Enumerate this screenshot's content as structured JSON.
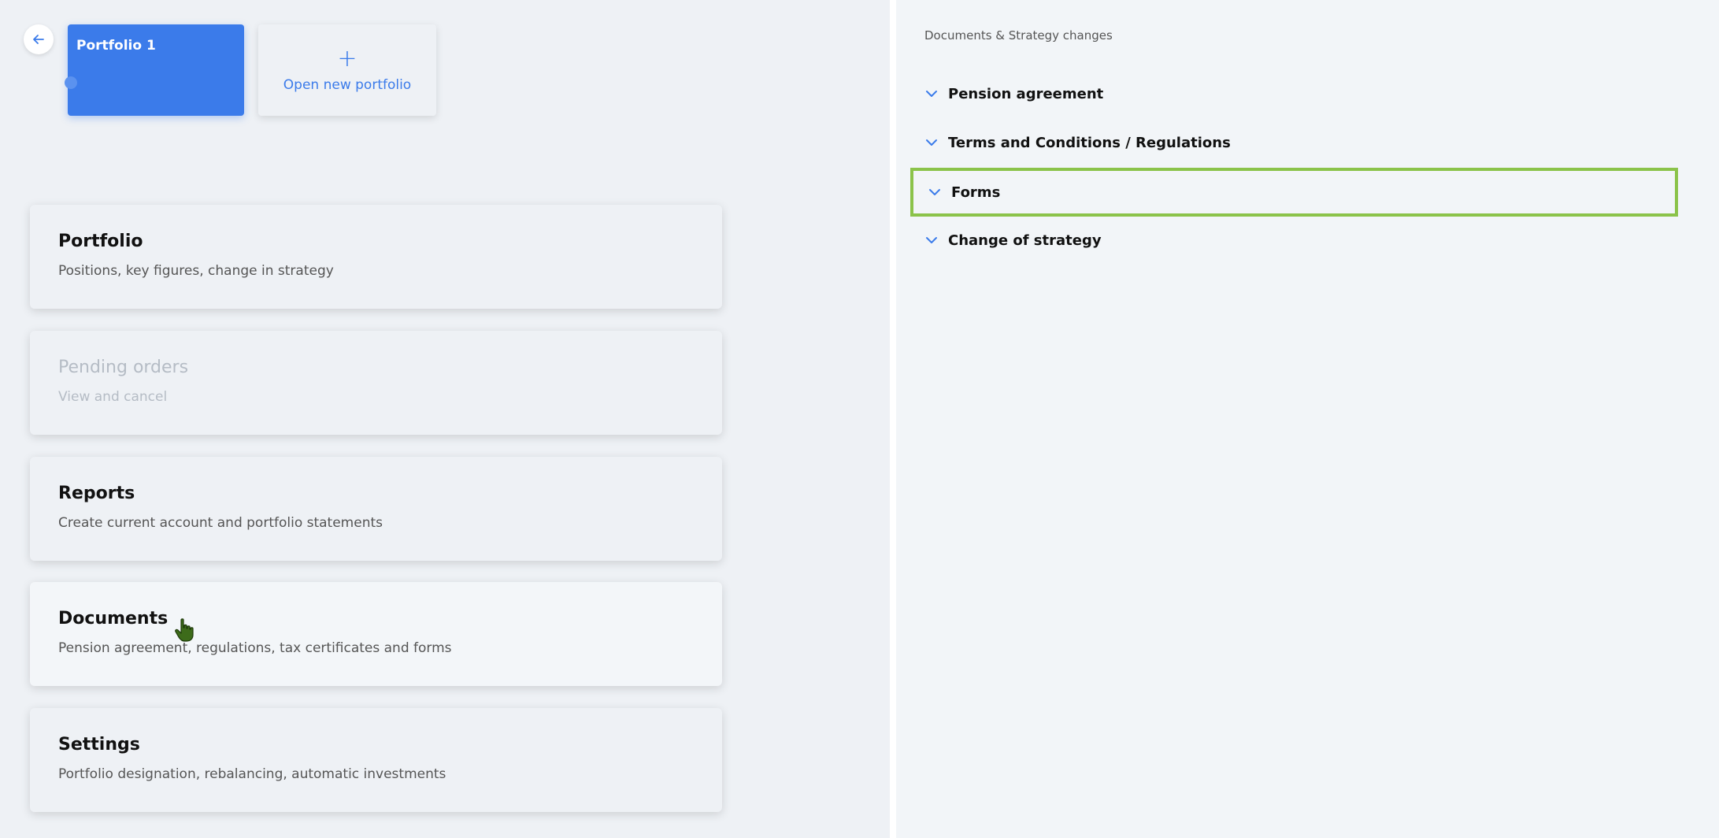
{
  "tabs": {
    "active_portfolio": "Portfolio 1",
    "open_new": "Open new portfolio"
  },
  "cards": [
    {
      "title": "Portfolio",
      "subtitle": "Positions, key figures, change in strategy"
    },
    {
      "title": "Pending orders",
      "subtitle": "View and cancel"
    },
    {
      "title": "Reports",
      "subtitle": "Create current account and portfolio statements"
    },
    {
      "title": "Documents",
      "subtitle": "Pension agreement, regulations, tax certificates and forms"
    },
    {
      "title": "Settings",
      "subtitle": "Portfolio designation, rebalancing, automatic investments"
    }
  ],
  "right": {
    "section_title": "Documents & Strategy changes",
    "items": [
      {
        "label": "Pension agreement"
      },
      {
        "label": "Terms and Conditions / Regulations"
      },
      {
        "label": "Forms"
      },
      {
        "label": "Change of strategy"
      }
    ]
  },
  "icons": {
    "back": "arrow-left-icon",
    "chevron": "chevron-down-icon",
    "cursor": "hand-cursor-icon"
  },
  "colors": {
    "accent": "#3b7bea",
    "selection_outline": "#8bc34a"
  }
}
